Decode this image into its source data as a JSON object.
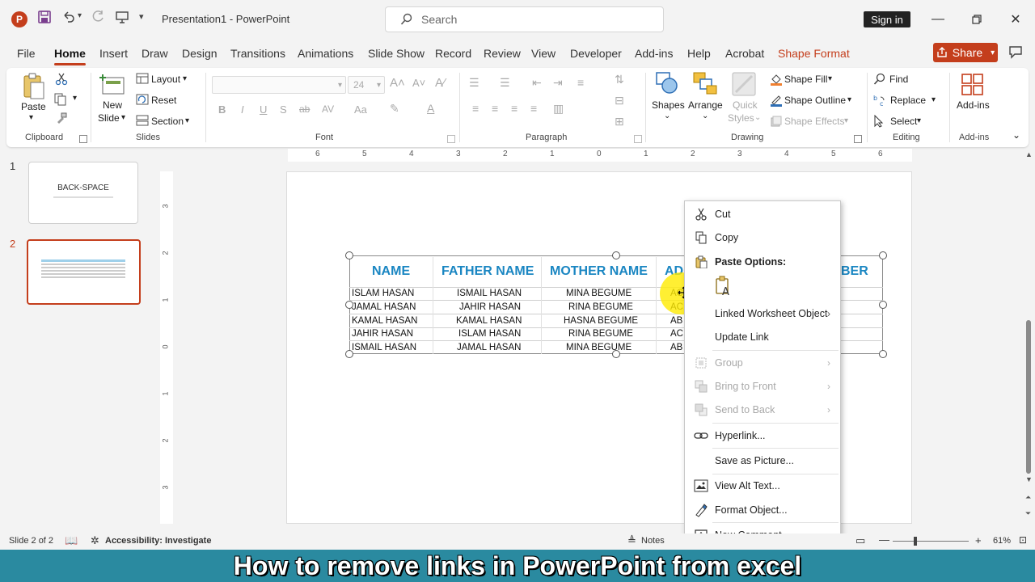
{
  "titlebar": {
    "app_initial": "P",
    "doc_title": "Presentation1  -  PowerPoint",
    "search_placeholder": "Search",
    "sign_in": "Sign in"
  },
  "tabs": [
    "File",
    "Home",
    "Insert",
    "Draw",
    "Design",
    "Transitions",
    "Animations",
    "Slide Show",
    "Record",
    "Review",
    "View",
    "Developer",
    "Add-ins",
    "Help",
    "Acrobat",
    "Shape Format"
  ],
  "share_label": "Share",
  "ribbon": {
    "clipboard": {
      "label": "Clipboard",
      "paste": "Paste"
    },
    "slides": {
      "label": "Slides",
      "new_slide_1": "New",
      "new_slide_2": "Slide",
      "layout": "Layout",
      "reset": "Reset",
      "section": "Section"
    },
    "font": {
      "label": "Font",
      "size": "24"
    },
    "paragraph": {
      "label": "Paragraph"
    },
    "drawing": {
      "label": "Drawing",
      "shapes": "Shapes",
      "arrange": "Arrange",
      "quick_styles_1": "Quick",
      "quick_styles_2": "Styles",
      "shape_fill": "Shape Fill",
      "shape_outline": "Shape Outline",
      "shape_effects": "Shape Effects"
    },
    "editing": {
      "label": "Editing",
      "find": "Find",
      "replace": "Replace",
      "select": "Select"
    },
    "addins": {
      "label": "Add-ins",
      "button": "Add-ins"
    }
  },
  "thumbnails": {
    "slide1_num": "1",
    "slide1_title": "BACK-SPACE",
    "slide2_num": "2"
  },
  "ruler_h": [
    "6",
    "5",
    "4",
    "3",
    "2",
    "1",
    "0",
    "1",
    "2",
    "3",
    "4",
    "5",
    "6"
  ],
  "ruler_v": [
    "3",
    "2",
    "1",
    "0",
    "1",
    "2",
    "3"
  ],
  "table": {
    "headers": [
      "NAME",
      "FATHER NAME",
      "MOTHER NAME",
      "AD",
      "BER"
    ],
    "rows": [
      [
        "ISLAM HASAN",
        "ISMAIL HASAN",
        "MINA BEGUME",
        "AC"
      ],
      [
        "JAMAL HASAN",
        "JAHIR HASAN",
        "RINA BEGUME",
        "AC"
      ],
      [
        "KAMAL HASAN",
        "KAMAL HASAN",
        "HASNA BEGUME",
        "AB"
      ],
      [
        "JAHIR HASAN",
        "ISLAM HASAN",
        "RINA BEGUME",
        "AC"
      ],
      [
        "ISMAIL HASAN",
        "JAMAL HASAN",
        "MINA BEGUME",
        "AB"
      ]
    ]
  },
  "context_menu": {
    "cut": "Cut",
    "copy": "Copy",
    "paste_options": "Paste Options:",
    "linked_worksheet_object": "Linked Worksheet Object",
    "update_link": "Update Link",
    "group": "Group",
    "bring_to_front": "Bring to Front",
    "send_to_back": "Send to Back",
    "hyperlink": "Hyperlink...",
    "save_as_picture": "Save as Picture...",
    "view_alt_text": "View Alt Text...",
    "format_object": "Format Object...",
    "new_comment": "New Comment"
  },
  "status": {
    "slide_of": "Slide 2 of 2",
    "accessibility": "Accessibility: Investigate",
    "notes": "Notes",
    "zoom": "61%"
  },
  "caption": "How to remove links in PowerPoint from excel"
}
